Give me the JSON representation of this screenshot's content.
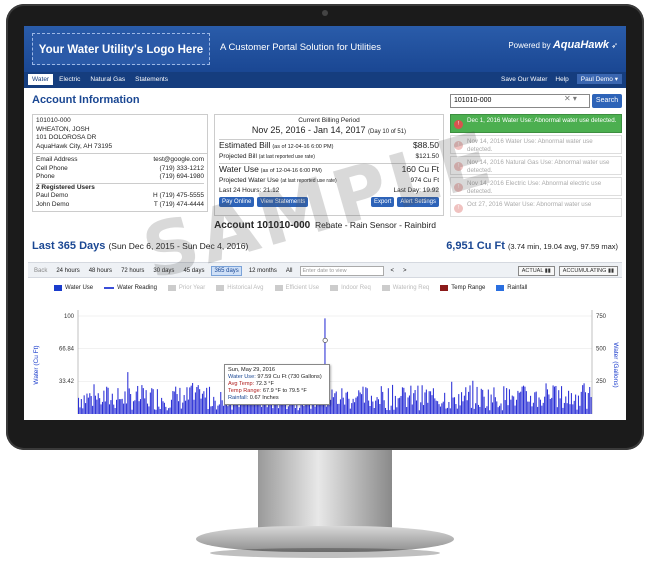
{
  "banner": {
    "logo_text": "Your Water Utility's Logo Here",
    "tagline": "A Customer Portal Solution for Utilities",
    "powered_by": "Powered by",
    "brand": "AquaHawk"
  },
  "nav": {
    "tabs": [
      {
        "label": "Water",
        "active": true
      },
      {
        "label": "Electric",
        "active": false
      },
      {
        "label": "Natural Gas",
        "active": false
      },
      {
        "label": "Statements",
        "active": false
      }
    ],
    "links": [
      "Save Our Water",
      "Help"
    ],
    "user": "Paul Demo"
  },
  "account_info": {
    "title": "Account Information",
    "search_value": "101010-000",
    "search_button": "Search",
    "account_number": "101010-000",
    "name": "WHEATON, JOSH",
    "street": "101 DOLOROSA DR",
    "city": "AquaHawk City, AH 73195",
    "email_label": "Email Address",
    "email": "test@google.com",
    "cell_label": "Cell Phone",
    "cell": "(719) 333-1212",
    "phone_label": "Phone",
    "phone": "(719) 694-1980",
    "registered_label": "2 Registered Users",
    "users": [
      {
        "name": "Paul Demo",
        "phone": "H (719) 475-5555"
      },
      {
        "name": "John Demo",
        "phone": "T (719) 474-4444"
      }
    ]
  },
  "billing": {
    "header": "Current Billing Period",
    "range": "Nov 25, 2016 - Jan 14, 2017",
    "day_note": "(Day 10 of 51)",
    "est_label": "Estimated Bill",
    "est_note": "(as of 12-04-16 6:00 PM)",
    "est_value": "$88.50",
    "proj_label": "Projected Bill",
    "proj_note": "(at last reported use rate)",
    "proj_value": "$121.50",
    "use_label": "Water Use",
    "use_note": "(as of 12-04-16 6:00 PM)",
    "use_value": "160 Cu Ft",
    "proj_use_label": "Projected Water Use",
    "proj_use_note": "(at last reported use rate)",
    "proj_use_value": "974 Cu Ft",
    "last24_label": "Last 24 Hours: 21.12",
    "lastday_label": "Last Day: 19.92",
    "buttons": [
      "Pay Online",
      "View Statements",
      "Export",
      "Alert Settings"
    ]
  },
  "alerts": [
    {
      "date": "Dec 1, 2016",
      "text": "Water Use: Abnormal water use detected.",
      "active": true
    },
    {
      "date": "Nov 14, 2016",
      "text": "Water Use: Abnormal water use detected.",
      "active": false
    },
    {
      "date": "Nov 14, 2016",
      "text": "Natural Gas Use: Abnormal water use detected.",
      "active": false
    },
    {
      "date": "Nov 14, 2016",
      "text": "Electric Use: Abnormal electric use detected.",
      "active": false
    },
    {
      "date": "Oct 27, 2016",
      "text": "Water Use: Abnormal water use",
      "active": false
    }
  ],
  "account_bar": {
    "account": "Account 101010-000",
    "meta": "Rebate - Rain Sensor - Rainbird"
  },
  "period": {
    "title": "Last 365 Days",
    "range": "(Sun Dec 6, 2015 - Sun Dec 4, 2016)",
    "total": "6,951 Cu Ft",
    "stats": "(3.74 min, 19.04 avg, 97.59 max)"
  },
  "toolbar": {
    "back": "Back",
    "ranges": [
      "24 hours",
      "48 hours",
      "72 hours",
      "30 days",
      "45 days",
      "365 days",
      "12 months",
      "All"
    ],
    "active_range": "365 days",
    "date_placeholder": "Enter date to view",
    "prev": "<",
    "next": ">",
    "actual": "ACTUAL",
    "accumulating": "ACCUMULATING"
  },
  "legend": [
    {
      "label": "Water Use",
      "color": "#1a3ccc",
      "type": "box",
      "on": true
    },
    {
      "label": "Water Reading",
      "color": "#3b4ed8",
      "type": "line",
      "on": true
    },
    {
      "label": "Prior Year",
      "color": "#cccccc",
      "type": "box",
      "on": false
    },
    {
      "label": "Historical Avg",
      "color": "#cccccc",
      "type": "box",
      "on": false
    },
    {
      "label": "Efficient Use",
      "color": "#cccccc",
      "type": "box",
      "on": false
    },
    {
      "label": "Indoor Req",
      "color": "#cccccc",
      "type": "box",
      "on": false
    },
    {
      "label": "Watering Req",
      "color": "#cccccc",
      "type": "box",
      "on": false
    },
    {
      "label": "Temp Range",
      "color": "#8b1a1a",
      "type": "box",
      "on": true
    },
    {
      "label": "Rainfall",
      "color": "#2a6fe0",
      "type": "box",
      "on": true
    }
  ],
  "chart_data": {
    "type": "bar",
    "ylabel": "Water (Cu Ft)",
    "y2label": "Water (Gallons)",
    "y_ticks": [
      "100",
      "66.84",
      "33.42"
    ],
    "y2_ticks": [
      "750",
      "500",
      "250"
    ],
    "ylim": [
      0,
      100
    ],
    "peak": {
      "value": 97.59,
      "index": 175
    },
    "days": 365,
    "avg": 19.04,
    "min": 3.74
  },
  "tooltip": {
    "date": "Sun, May 29, 2016",
    "use_label": "Water Use:",
    "use_value": "97.59 Cu Ft (730 Gallons)",
    "temp_label": "Avg Temp:",
    "temp_value": "72.3 °F",
    "range_label": "Temp Range:",
    "range_value": "67.9 °F to 79.5 °F",
    "rain_label": "Rainfall:",
    "rain_value": "0.67 Inches"
  },
  "watermark": "SAMPLE",
  "colors": {
    "primary": "#1a4793",
    "button": "#2d63b8",
    "alert_green": "#4caf50",
    "bar": "#2a2fd6"
  }
}
